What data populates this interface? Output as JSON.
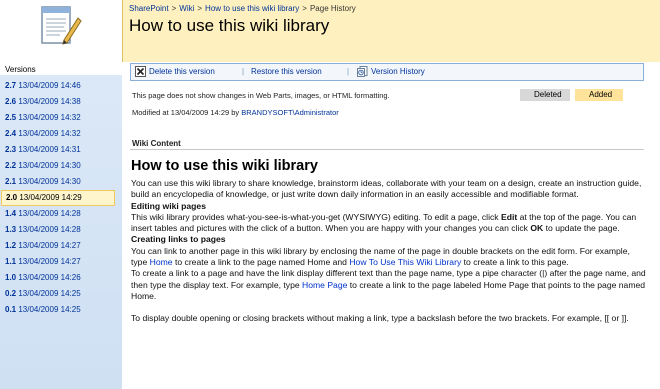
{
  "breadcrumb": [
    "SharePoint",
    "Wiki",
    "How to use this wiki library",
    "Page History"
  ],
  "page_title": "How to use this wiki library",
  "versions_heading": "Versions",
  "versions": [
    {
      "num": "2.7",
      "date": "13/04/2009 14:46",
      "selected": false
    },
    {
      "num": "2.6",
      "date": "13/04/2009 14:38",
      "selected": false
    },
    {
      "num": "2.5",
      "date": "13/04/2009 14:32",
      "selected": false
    },
    {
      "num": "2.4",
      "date": "13/04/2009 14:32",
      "selected": false
    },
    {
      "num": "2.3",
      "date": "13/04/2009 14:31",
      "selected": false
    },
    {
      "num": "2.2",
      "date": "13/04/2009 14:30",
      "selected": false
    },
    {
      "num": "2.1",
      "date": "13/04/2009 14:30",
      "selected": false
    },
    {
      "num": "2.0",
      "date": "13/04/2009 14:29",
      "selected": true
    },
    {
      "num": "1.4",
      "date": "13/04/2009 14:28",
      "selected": false
    },
    {
      "num": "1.3",
      "date": "13/04/2009 14:28",
      "selected": false
    },
    {
      "num": "1.2",
      "date": "13/04/2009 14:27",
      "selected": false
    },
    {
      "num": "1.1",
      "date": "13/04/2009 14:27",
      "selected": false
    },
    {
      "num": "1.0",
      "date": "13/04/2009 14:26",
      "selected": false
    },
    {
      "num": "0.2",
      "date": "13/04/2009 14:25",
      "selected": false
    },
    {
      "num": "0.1",
      "date": "13/04/2009 14:25",
      "selected": false
    }
  ],
  "toolbar": {
    "delete": "Delete this version",
    "restore": "Restore this version",
    "history": "Version History",
    "separator": "|"
  },
  "info": {
    "no_changes": "This page does not show changes in Web Parts, images, or HTML formatting.",
    "legend_deleted": "Deleted",
    "legend_added": "Added",
    "modified_prefix": "Modified at 13/04/2009 14:29  by",
    "modified_by": "BRANDYSOFT\\Administrator"
  },
  "content": {
    "label": "Wiki Content",
    "title": "How to use this wiki library",
    "intro": "You can use this wiki library to share knowledge, brainstorm ideas, collaborate with your team on a design, create an instruction guide, build an encyclopedia of knowledge, or just write down daily information in an easily accessible and modifiable format.",
    "h_editing": "Editing wiki pages",
    "editing_1": "This wiki library provides what-you-see-is-what-you-get (WYSIWYG) editing. To edit a page, click ",
    "editing_edit": "Edit",
    "editing_2": " at the top of the page. You can insert tables and pictures with the click of a button. When you are happy with your changes you can click ",
    "editing_ok": "OK",
    "editing_3": " to update the page.",
    "h_links": "Creating links to pages",
    "links_1": "You can link to another page in this wiki library by enclosing the name of the page in double brackets on the edit form. For example, type ",
    "links_home": "Home",
    "links_2": " to create a link to the page named Home and ",
    "links_howto": "How To Use This Wiki Library",
    "links_3": " to create a link to this page.",
    "display_1": "To create a link to a page and have the link display different text than the page name, type a pipe character (|) after the page name, and then type the display text. For example, type ",
    "display_homepage": "Home Page",
    "display_2": " to create a link to the page labeled Home Page that points to the page named Home.",
    "escape": "To display double opening or closing brackets without making a link, type a backslash before the two brackets. For example, [[ or ]]."
  },
  "colors": {
    "header_bg": "#fff1bf",
    "version_list_bg": "#dbe8f7",
    "selected_bg": "#fff5cc",
    "link": "#003399",
    "deleted": "#d8d8d8",
    "added": "#ffe39b"
  }
}
